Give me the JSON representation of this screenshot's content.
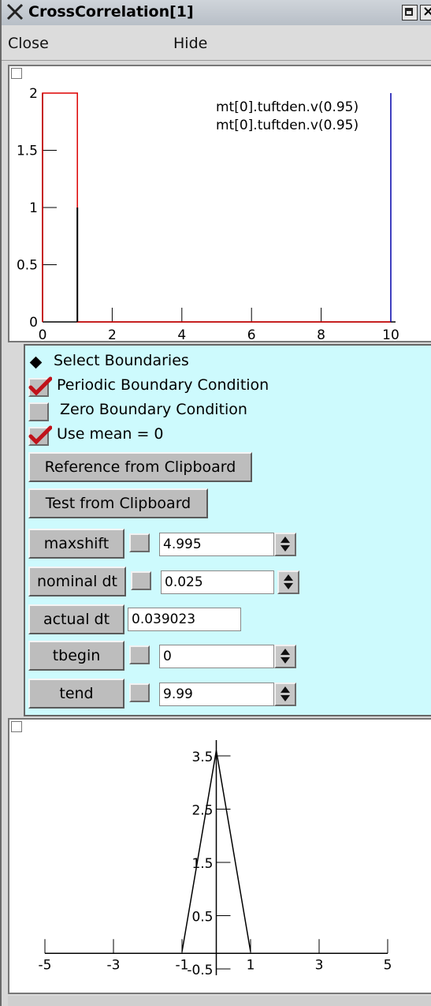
{
  "window": {
    "title": "CrossCorrelation[1]"
  },
  "menu": {
    "close": "Close",
    "hide": "Hide"
  },
  "plot1": {
    "legend": [
      "mt[0].tuftden.v(0.95)",
      "mt[0].tuftden.v(0.95)"
    ],
    "yticks": [
      "2",
      "1.5",
      "1",
      "0.5",
      "0"
    ],
    "xticks": [
      "0",
      "2",
      "4",
      "6",
      "8",
      "10"
    ]
  },
  "panel": {
    "select_label": "Select Boundaries",
    "periodic_label": "Periodic Boundary Condition",
    "periodic_checked": true,
    "zero_label": "Zero  Boundary Condition",
    "zero_checked": false,
    "mean_label": "Use mean = 0",
    "mean_checked": true,
    "ref_button": "Reference from Clipboard",
    "test_button": "Test from Clipboard",
    "maxshift": {
      "label": "maxshift",
      "value": "4.995"
    },
    "nominal_dt": {
      "label": "nominal dt",
      "value": "0.025"
    },
    "actual_dt": {
      "label": "actual dt",
      "value": "0.039023"
    },
    "tbegin": {
      "label": "tbegin",
      "value": "0"
    },
    "tend": {
      "label": "tend",
      "value": "9.99"
    }
  },
  "chart_data": [
    {
      "type": "line",
      "xlim": [
        0,
        10
      ],
      "ylim": [
        0,
        2
      ],
      "series": [
        {
          "name": "mt[0].tuftden.v(0.95)",
          "color": "#dd0000",
          "x": [
            0,
            0,
            1,
            1,
            10
          ],
          "y": [
            0,
            2,
            2,
            0,
            0
          ]
        },
        {
          "name": "mt[0].tuftden.v(0.95)",
          "color": "#000000",
          "x": [
            1,
            1,
            1
          ],
          "y": [
            0,
            1,
            0
          ]
        },
        {
          "color": "#0000aa",
          "x": [
            10,
            10
          ],
          "y": [
            0,
            2
          ]
        }
      ],
      "xticks": [
        0,
        2,
        4,
        6,
        8,
        10
      ],
      "yticks": [
        0,
        0.5,
        1,
        1.5,
        2
      ]
    },
    {
      "type": "line",
      "xlim": [
        -5,
        5
      ],
      "ylim": [
        -0.5,
        3.5
      ],
      "series": [
        {
          "color": "#000000",
          "x": [
            -1,
            0,
            1
          ],
          "y": [
            0,
            3.6,
            0
          ]
        }
      ],
      "xticks": [
        "-5",
        "-3",
        "-1",
        "1",
        "3",
        "5"
      ],
      "yticks": [
        "3.5",
        "2.5",
        "1.5",
        "0.5",
        "-0.5"
      ]
    }
  ]
}
